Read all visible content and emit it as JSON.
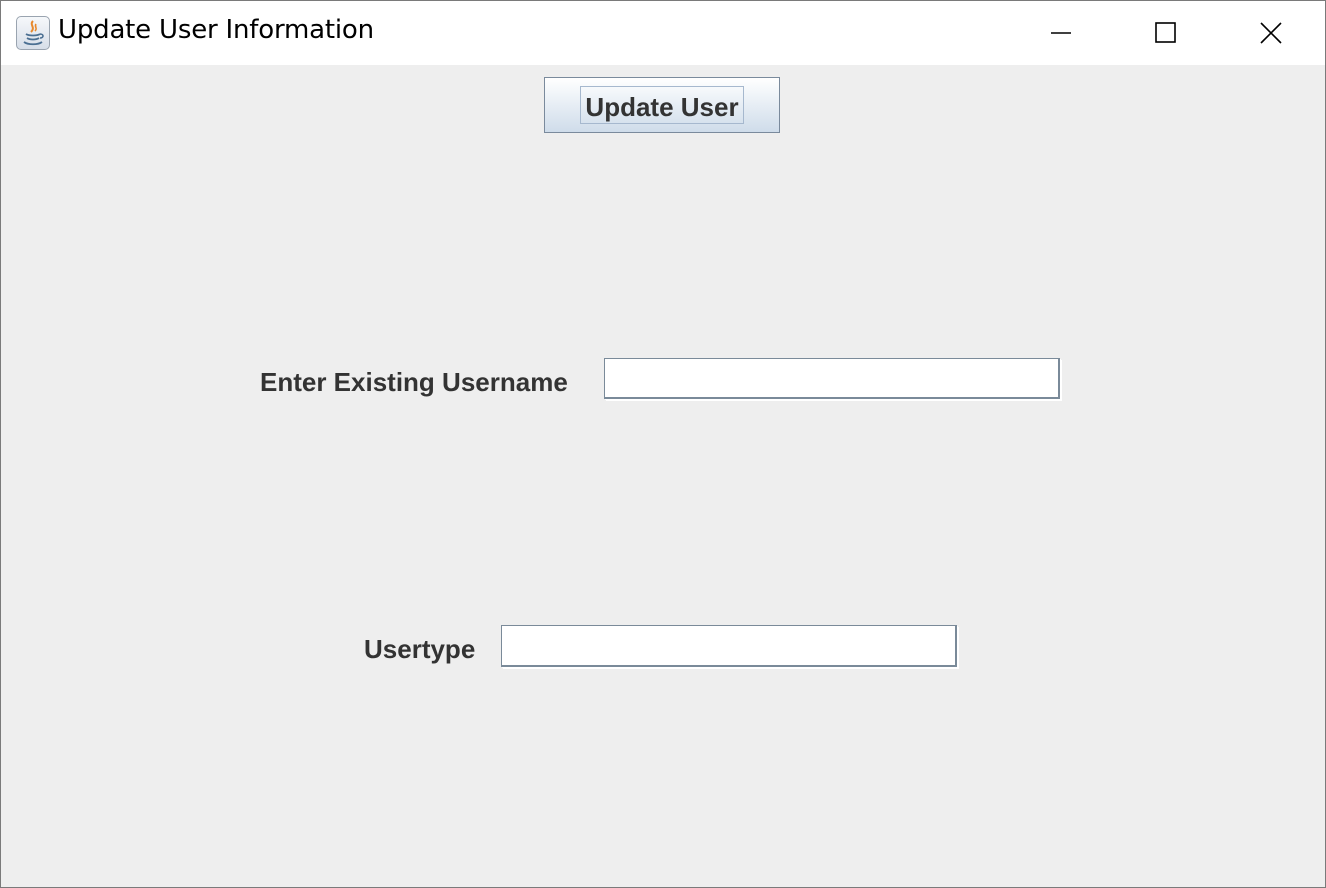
{
  "window": {
    "title": "Update User Information",
    "icon": "java-icon",
    "controls": [
      "minimize-icon",
      "maximize-icon",
      "close-icon"
    ]
  },
  "form": {
    "update_button_label": "Update User",
    "username_label": "Enter Existing Username",
    "username_value": "",
    "usertype_label": "Usertype",
    "usertype_value": ""
  },
  "colors": {
    "background": "#eeeeee",
    "titlebar": "#ffffff",
    "label_text": "#333333",
    "field_border": "#7a8a99"
  }
}
